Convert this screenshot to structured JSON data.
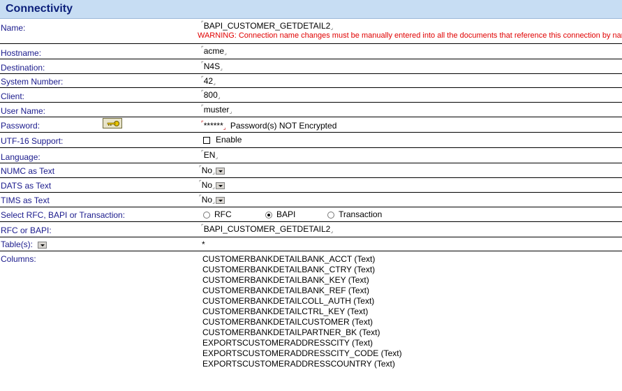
{
  "header": {
    "title": "Connectivity"
  },
  "name": {
    "label": "Name:",
    "value": "BAPI_CUSTOMER_GETDETAIL2",
    "warning": "WARNING: Connection name changes must be manually entered into all the documents that reference this connection by name."
  },
  "hostname": {
    "label": "Hostname:",
    "value": "acme"
  },
  "destination": {
    "label": "Destination:",
    "value": "N4S"
  },
  "system_number": {
    "label": "System Number:",
    "value": "42"
  },
  "client": {
    "label": "Client:",
    "value": "800"
  },
  "user_name": {
    "label": "User Name:",
    "value": "muster"
  },
  "password": {
    "label": "Password:",
    "value": "******",
    "note": "Password(s) NOT Encrypted"
  },
  "utf16": {
    "label": "UTF-16 Support:",
    "option": "Enable",
    "checked": false
  },
  "language": {
    "label": "Language:",
    "value": "EN"
  },
  "numc": {
    "label": "NUMC as Text",
    "value": "No"
  },
  "dats": {
    "label": "DATS as Text",
    "value": "No"
  },
  "tims": {
    "label": "TIMS as Text",
    "value": "No"
  },
  "select_type": {
    "label": "Select RFC, BAPI or Transaction:",
    "options": [
      "RFC",
      "BAPI",
      "Transaction"
    ],
    "selected": "BAPI"
  },
  "rfc_bapi": {
    "label": "RFC or BAPI:",
    "value": "BAPI_CUSTOMER_GETDETAIL2"
  },
  "tables": {
    "label": "Table(s):",
    "value": "*"
  },
  "columns": {
    "label": "Columns:",
    "items": [
      "CUSTOMERBANKDETAILBANK_ACCT (Text)",
      "CUSTOMERBANKDETAILBANK_CTRY (Text)",
      "CUSTOMERBANKDETAILBANK_KEY (Text)",
      "CUSTOMERBANKDETAILBANK_REF (Text)",
      "CUSTOMERBANKDETAILCOLL_AUTH (Text)",
      "CUSTOMERBANKDETAILCTRL_KEY (Text)",
      "CUSTOMERBANKDETAILCUSTOMER (Text)",
      "CUSTOMERBANKDETAILPARTNER_BK (Text)",
      "EXPORTSCUSTOMERADDRESSCITY (Text)",
      "EXPORTSCUSTOMERADDRESSCITY_CODE (Text)",
      "EXPORTSCUSTOMERADDRESSCOUNTRY (Text)"
    ]
  }
}
